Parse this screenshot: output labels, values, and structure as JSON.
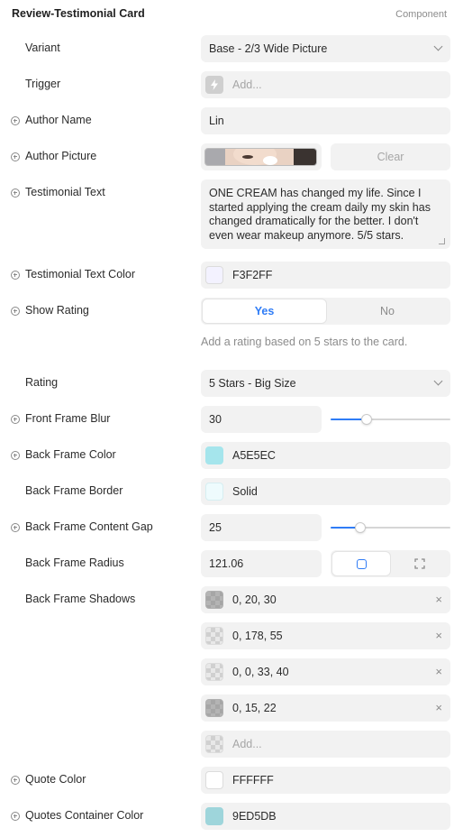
{
  "header": {
    "title": "Review-Testimonial Card",
    "tag": "Component"
  },
  "variant": {
    "label": "Variant",
    "value": "Base - 2/3 Wide Picture"
  },
  "trigger": {
    "label": "Trigger",
    "placeholder": "Add..."
  },
  "author_name": {
    "label": "Author Name",
    "value": "Lin"
  },
  "author_picture": {
    "label": "Author Picture",
    "clear_label": "Clear"
  },
  "testimonial_text": {
    "label": "Testimonial Text",
    "value": "ONE CREAM has changed my life. Since I started applying the cream daily my skin has changed dramatically for the better. I don't even wear makeup anymore. 5/5 stars."
  },
  "testimonial_text_color": {
    "label": "Testimonial Text Color",
    "value": "F3F2FF",
    "swatch": "#F3F2FF"
  },
  "show_rating": {
    "label": "Show Rating",
    "yes": "Yes",
    "no": "No",
    "hint": "Add a rating based on 5 stars to the card."
  },
  "rating": {
    "label": "Rating",
    "value": "5 Stars - Big Size"
  },
  "front_frame_blur": {
    "label": "Front Frame Blur",
    "value": "30",
    "slider_fraction": 0.3
  },
  "back_frame_color": {
    "label": "Back Frame Color",
    "value": "A5E5EC",
    "swatch": "#A5E5EC"
  },
  "back_frame_border": {
    "label": "Back Frame Border",
    "value": "Solid",
    "swatch": "#EEFBFD"
  },
  "back_frame_content_gap": {
    "label": "Back Frame Content Gap",
    "value": "25",
    "slider_fraction": 0.25
  },
  "back_frame_radius": {
    "label": "Back Frame Radius",
    "value": "121.06"
  },
  "back_frame_shadows": {
    "label": "Back Frame Shadows",
    "items": [
      {
        "value": "0, 20, 30"
      },
      {
        "value": "0, 178, 55"
      },
      {
        "value": "0, 0, 33, 40"
      },
      {
        "value": "0, 15, 22"
      }
    ],
    "add_placeholder": "Add..."
  },
  "quote_color": {
    "label": "Quote Color",
    "value": "FFFFFF",
    "swatch": "#FFFFFF"
  },
  "quotes_container_color": {
    "label": "Quotes Container Color",
    "value": "9ED5DB",
    "swatch": "#9ED5DB"
  },
  "icons": {
    "lightning": "lightning-icon",
    "close": "close-icon",
    "chevron": "chevron-down-icon",
    "plus": "plus-circle-icon",
    "square": "square-icon",
    "expand": "expand-icon"
  },
  "colors": {
    "accent": "#2F7CF6"
  }
}
